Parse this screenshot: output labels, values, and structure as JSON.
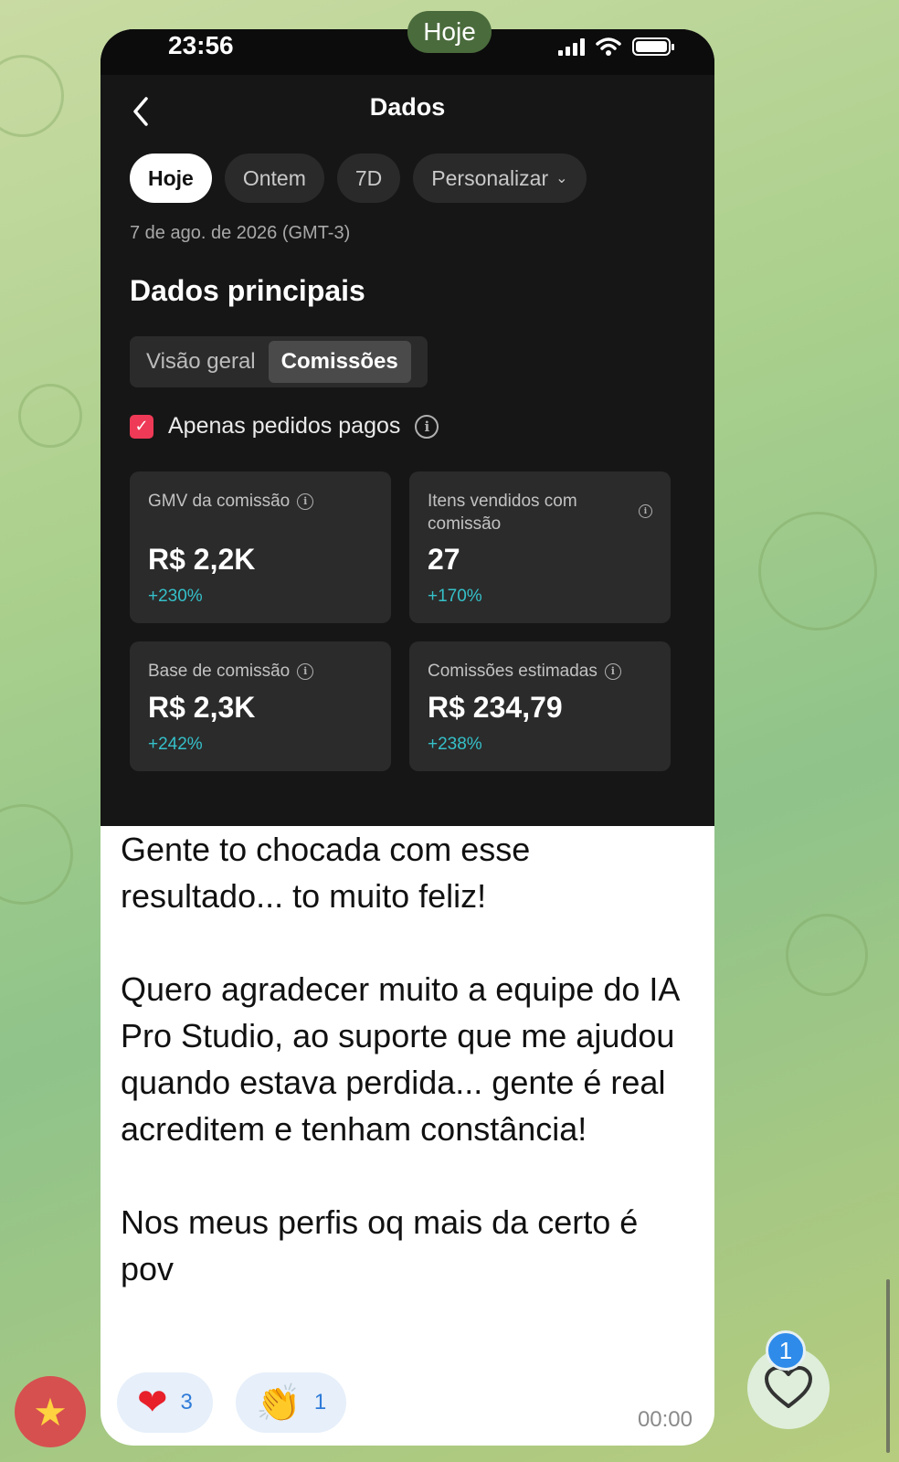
{
  "chat": {
    "date_separator": "Hoje",
    "message": {
      "paragraphs": [
        "Gente to chocada com esse resultado... to muito feliz!",
        "Quero agradecer muito a equipe do IA Pro Studio, ao suporte que me ajudou quando estava perdida... gente é real acreditem e tenham constância!",
        "Nos meus perfis oq mais da certo é pov"
      ],
      "time": "00:00",
      "reactions": [
        {
          "emoji": "❤",
          "icon": "heart-icon",
          "count": "3"
        },
        {
          "emoji": "👏",
          "icon": "clapping-hands-icon",
          "count": "1"
        }
      ]
    },
    "unread_badge": "1",
    "avatar_icon": "star-face-icon"
  },
  "screenshot": {
    "status_bar": {
      "time": "23:56",
      "icons": [
        "signal-icon",
        "wifi-icon",
        "battery-icon"
      ]
    },
    "nav": {
      "title": "Dados",
      "back_icon": "chevron-left-icon"
    },
    "period_tabs": [
      {
        "label": "Hoje",
        "active": true
      },
      {
        "label": "Ontem",
        "active": false
      },
      {
        "label": "7D",
        "active": false
      },
      {
        "label": "Personalizar",
        "active": false,
        "icon": "chevron-down-icon"
      }
    ],
    "date_label": "7 de ago. de 2026 (GMT-3)",
    "section_title": "Dados principais",
    "segments": [
      {
        "label": "Visão geral",
        "active": false
      },
      {
        "label": "Comissões",
        "active": true
      }
    ],
    "filter": {
      "label": "Apenas pedidos pagos",
      "checked": true
    },
    "metrics": [
      {
        "label": "GMV da comissão",
        "value": "R$ 2,2K",
        "change": "+230%"
      },
      {
        "label": "Itens vendidos com comissão",
        "value": "27",
        "change": "+170%"
      },
      {
        "label": "Base de comissão",
        "value": "R$ 2,3K",
        "change": "+242%"
      },
      {
        "label": "Comissões estimadas",
        "value": "R$ 234,79",
        "change": "+238%"
      }
    ],
    "accent_color": "#ee3a56",
    "positive_color": "#35c0c9"
  }
}
